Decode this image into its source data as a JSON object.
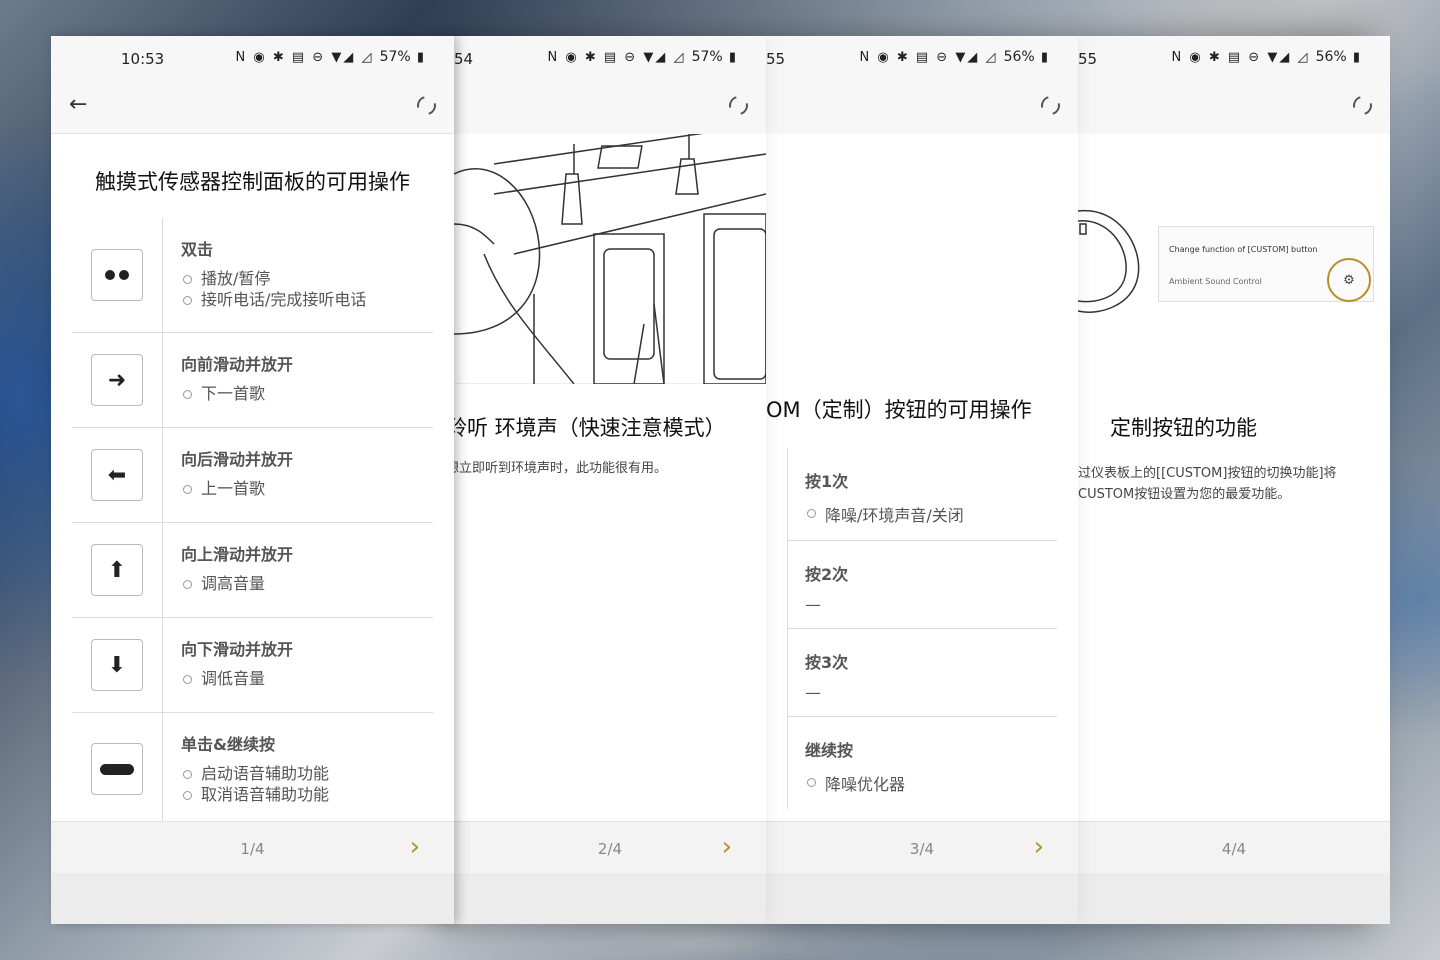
{
  "screens": [
    {
      "time": "10:53",
      "battery": "57%",
      "title": "触摸式传感器控制面板的可用操作",
      "operations": [
        {
          "name": "双击",
          "subs": [
            "播放/暂停",
            "接听电话/完成接听电话"
          ],
          "icon": "double-dot-icon"
        },
        {
          "name": "向前滑动并放开",
          "subs": [
            "下一首歌"
          ],
          "icon": "arrow-right-icon"
        },
        {
          "name": "向后滑动并放开",
          "subs": [
            "上一首歌"
          ],
          "icon": "arrow-left-icon"
        },
        {
          "name": "向上滑动并放开",
          "subs": [
            "调高音量"
          ],
          "icon": "arrow-up-icon"
        },
        {
          "name": "向下滑动并放开",
          "subs": [
            "调低音量"
          ],
          "icon": "arrow-down-icon"
        },
        {
          "name": "单击&继续按",
          "subs": [
            "启动语音辅助功能",
            "取消语音辅助功能"
          ],
          "icon": "long-press-icon"
        }
      ],
      "page": "1/4"
    },
    {
      "time": "54",
      "battery": "57%",
      "title": "聆听 环境声（快速注意模式）",
      "desc": "想立即听到环境声时，此功能很有用。",
      "page": "2/4"
    },
    {
      "time": "55",
      "battery": "56%",
      "title": "OM（定制）按钮的可用操作",
      "presses": [
        {
          "name": "按1次",
          "sub": "降噪/环境声音/关闭",
          "bullet": true
        },
        {
          "name": "按2次",
          "sub": "—",
          "bullet": false
        },
        {
          "name": "按3次",
          "sub": "—",
          "bullet": false
        },
        {
          "name": "继续按",
          "sub": "降噪优化器",
          "bullet": true
        }
      ],
      "page": "3/4"
    },
    {
      "time": "55",
      "battery": "56%",
      "title": "定制按钮的功能",
      "desc1": "过仪表板上的[[CUSTOM]按钮的切换功能]将",
      "desc2": "CUSTOM按钮设置为您的最爱功能。",
      "card_line1": "Change function of [CUSTOM] button",
      "card_line2": "Ambient Sound Control",
      "page": "4/4"
    }
  ],
  "colors": {
    "accent": "#b58f2e"
  }
}
